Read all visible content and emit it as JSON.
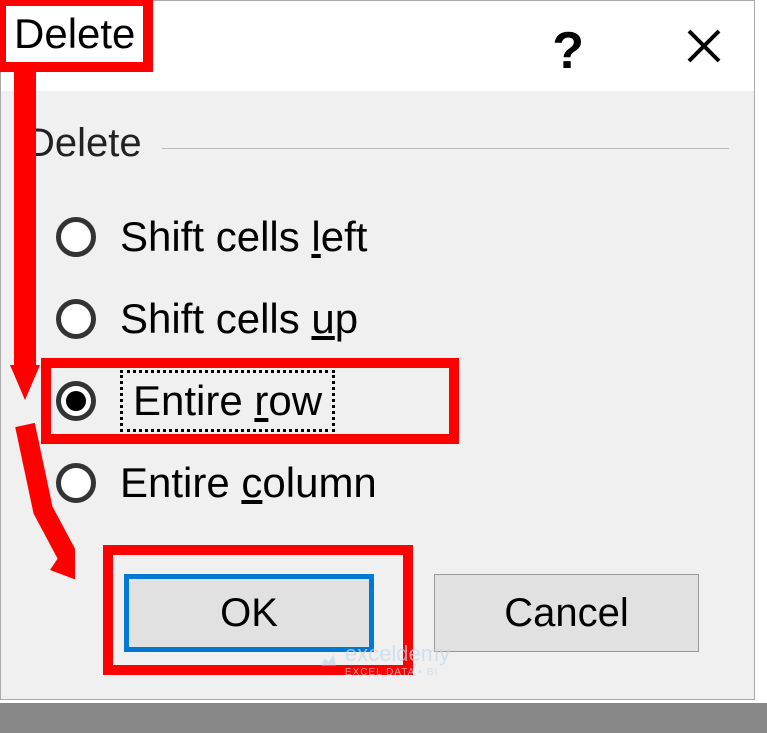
{
  "dialog": {
    "title": "Delete",
    "group_label": "Delete",
    "options": {
      "shift_left": "Shift cells left",
      "shift_up": "Shift cells up",
      "entire_row": "Entire row",
      "entire_column": "Entire column"
    },
    "buttons": {
      "ok": "OK",
      "cancel": "Cancel"
    }
  },
  "watermark": {
    "text": "exceldemy",
    "sub": "EXCEL DATA • BI"
  }
}
